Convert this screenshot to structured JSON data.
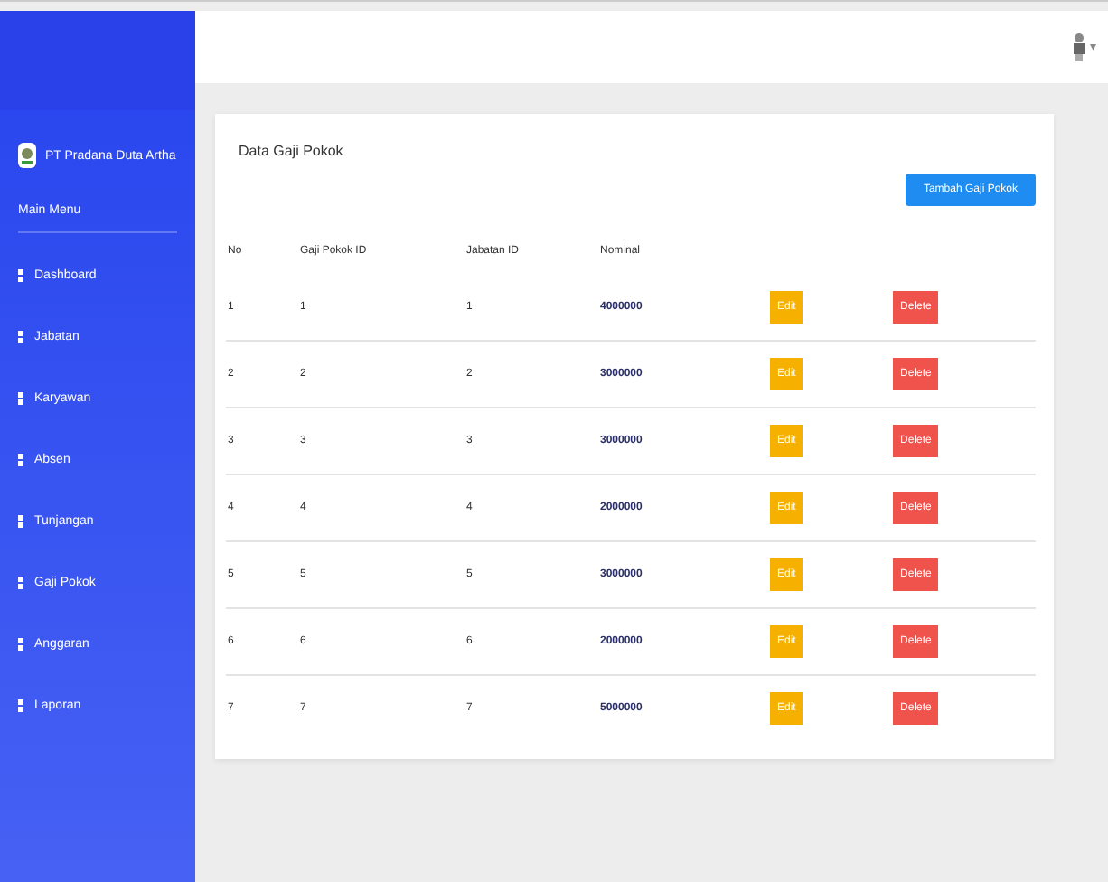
{
  "brand": {
    "name": "PT Pradana Duta Artha"
  },
  "sidebar": {
    "heading": "Main Menu",
    "items": [
      {
        "label": "Dashboard",
        "selected": false
      },
      {
        "label": "Jabatan",
        "selected": false
      },
      {
        "label": "Karyawan",
        "selected": false
      },
      {
        "label": "Absen",
        "selected": false
      },
      {
        "label": "Tunjangan",
        "selected": false
      },
      {
        "label": "Gaji Pokok",
        "selected": false
      },
      {
        "label": "Anggaran",
        "selected": false
      },
      {
        "label": "Laporan",
        "selected": false
      }
    ]
  },
  "user_menu": {
    "caret": "▾"
  },
  "card": {
    "title": "Data Gaji Pokok",
    "add_button": "Tambah Gaji Pokok"
  },
  "table": {
    "columns": [
      "No",
      "Gaji Pokok ID",
      "Jabatan ID",
      "Nominal"
    ],
    "rows": [
      {
        "cells": [
          "1",
          "1",
          "1",
          "4000000"
        ],
        "edit": "Edit",
        "delete": "Delete"
      },
      {
        "cells": [
          "2",
          "2",
          "2",
          "3000000"
        ],
        "edit": "Edit",
        "delete": "Delete"
      },
      {
        "cells": [
          "3",
          "3",
          "3",
          "3000000"
        ],
        "edit": "Edit",
        "delete": "Delete"
      },
      {
        "cells": [
          "4",
          "4",
          "4",
          "2000000"
        ],
        "edit": "Edit",
        "delete": "Delete"
      },
      {
        "cells": [
          "5",
          "5",
          "5",
          "3000000"
        ],
        "edit": "Edit",
        "delete": "Delete"
      },
      {
        "cells": [
          "6",
          "6",
          "6",
          "2000000"
        ],
        "edit": "Edit",
        "delete": "Delete"
      },
      {
        "cells": [
          "7",
          "7",
          "7",
          "5000000"
        ],
        "edit": "Edit",
        "delete": "Delete"
      }
    ]
  }
}
